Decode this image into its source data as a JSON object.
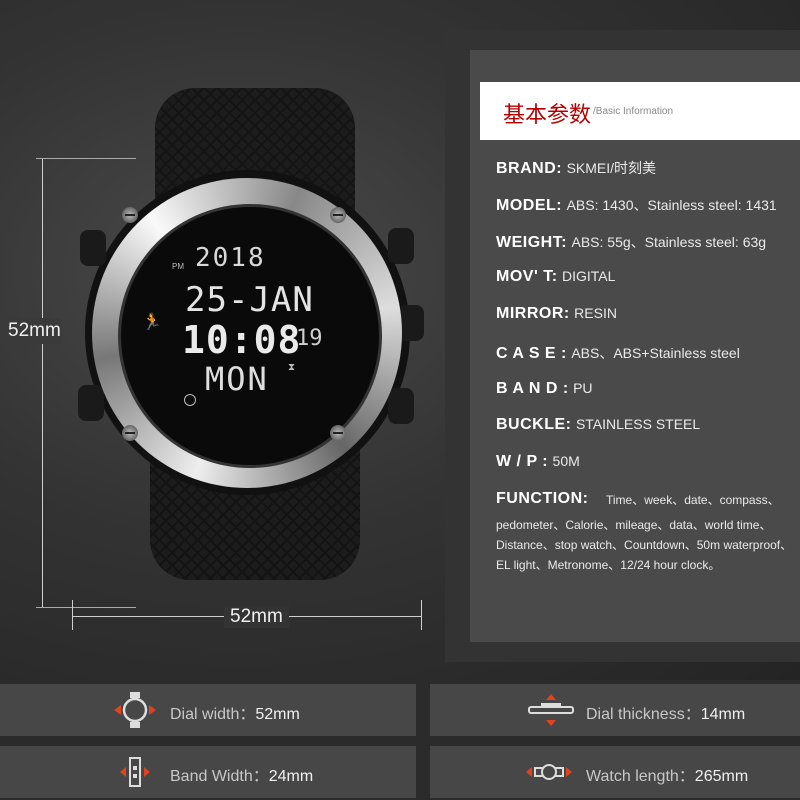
{
  "dimensions": {
    "height_label": "52mm",
    "width_label": "52mm"
  },
  "watch_display": {
    "year": "2018",
    "date": "25-JAN",
    "time": "10:08",
    "seconds": "19",
    "day": "MON",
    "pm": "PM"
  },
  "info": {
    "header_cn": "基本参数",
    "header_en": "/Basic Information",
    "rows": [
      {
        "key": "BRAND:",
        "value": "SKMEI/时刻美"
      },
      {
        "key": "MODEL:",
        "value": "ABS: 1430、Stainless steel: 1431"
      },
      {
        "key": "WEIGHT:",
        "value": "ABS: 55g、Stainless steel: 63g"
      },
      {
        "key": "MOV' T:",
        "value": "DIGITAL"
      },
      {
        "key": "MIRROR:",
        "value": "RESIN"
      },
      {
        "key": "C A S E :",
        "value": "ABS、ABS+Stainless steel"
      },
      {
        "key": "B A N D :",
        "value": "PU"
      },
      {
        "key": "BUCKLE:",
        "value": "STAINLESS STEEL"
      },
      {
        "key": "W / P :",
        "value": "50M"
      }
    ],
    "function_key": "FUNCTION:",
    "function_lines": [
      "Time、week、date、compass、",
      "pedometer、Calorie、mileage、data、world time、",
      "Distance、stop watch、Countdown、50m waterproof、",
      "EL light、Metronome、12/24 hour clock。"
    ]
  },
  "specs": [
    {
      "label": "Dial width：",
      "value": "52mm",
      "icon": "watch-dial-icon"
    },
    {
      "label": "Dial thickness：",
      "value": "14mm",
      "icon": "watch-thickness-icon"
    },
    {
      "label": "Band Width：",
      "value": "24mm",
      "icon": "band-width-icon"
    },
    {
      "label": "Watch length：",
      "value": "265mm",
      "icon": "watch-length-icon"
    }
  ],
  "colors": {
    "header_red": "#b40000",
    "arrow_red": "#e0431e"
  }
}
